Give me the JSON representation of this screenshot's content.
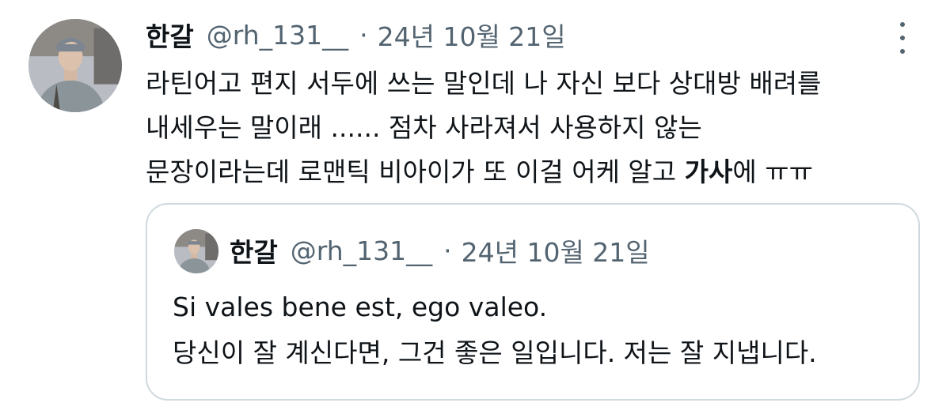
{
  "tweet": {
    "author_name": "한갈",
    "author_handle": "@rh_131__",
    "separator": "·",
    "date": "24년 10월 21일",
    "text_line1": "라틴어고 편지 서두에 쓰는 말인데 나 자신 보다 상대방 배려를",
    "text_line2": "내세우는 말이래 ...... 점차 사라져서 사용하지 않는",
    "text_line3_before": "문장이라는데 로맨틱 비아이가 또 이걸 어케 알고 ",
    "text_line3_bold": "가사",
    "text_line3_after": "에 ㅠㅠ"
  },
  "quoted_tweet": {
    "author_name": "한갈",
    "author_handle": "@rh_131__",
    "separator": "·",
    "date": "24년 10월 21일",
    "text_line1": "Si vales bene est, ego valeo.",
    "text_line2": "당신이 잘 계신다면, 그건 좋은 일입니다. 저는 잘 지냅니다."
  },
  "icons": {
    "more": "more-vertical-icon"
  },
  "colors": {
    "text_primary": "#0f1419",
    "text_secondary": "#536471",
    "border": "#cfd9de"
  }
}
